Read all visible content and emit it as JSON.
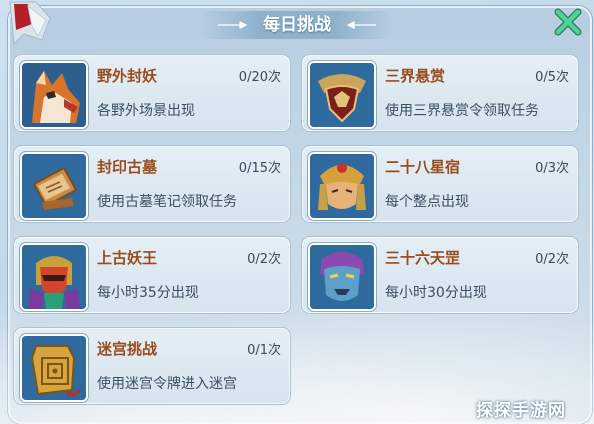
{
  "panel": {
    "title": "每日挑战"
  },
  "icons": {
    "close": "close-icon",
    "flag": "flag-icon"
  },
  "colors": {
    "name": "#9a4d1c",
    "count": "#3a4a58",
    "desc": "#3a4f62",
    "close": "#3fc08a"
  },
  "tasks": [
    {
      "name": "野外封妖",
      "count": "0/20次",
      "desc": "各野外场景出现",
      "portrait": "fox-demon-portrait-icon"
    },
    {
      "name": "三界悬赏",
      "count": "0/5次",
      "desc": "使用三界悬赏令领取任务",
      "portrait": "bounty-emblem-portrait-icon"
    },
    {
      "name": "封印古墓",
      "count": "0/15次",
      "desc": "使用古墓笔记领取任务",
      "portrait": "tomb-notes-portrait-icon"
    },
    {
      "name": "二十八星宿",
      "count": "0/3次",
      "desc": "每个整点出现",
      "portrait": "warrior-portrait-icon"
    },
    {
      "name": "上古妖王",
      "count": "0/2次",
      "desc": "每小时35分出现",
      "portrait": "demon-king-portrait-icon"
    },
    {
      "name": "三十六天罡",
      "count": "0/2次",
      "desc": "每小时30分出现",
      "portrait": "blue-demon-portrait-icon"
    },
    {
      "name": "迷宫挑战",
      "count": "0/1次",
      "desc": "使用迷宫令牌进入迷宫",
      "portrait": "maze-token-portrait-icon"
    }
  ],
  "watermark": "探探手游网"
}
